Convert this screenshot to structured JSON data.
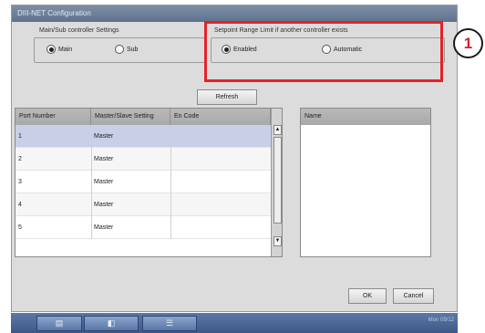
{
  "window": {
    "title": "DIII-NET Configuration"
  },
  "main_sub": {
    "label": "Main/Sub controller Settings",
    "options": [
      "Main",
      "Sub"
    ],
    "selected": "Main"
  },
  "setpoint": {
    "label": "Setpoint Range Limit if another controller exists",
    "options": [
      "Enabled",
      "Automatic"
    ],
    "selected": "Enabled"
  },
  "refresh_label": "Refresh",
  "ports_table": {
    "headers": [
      "Port Number",
      "Master/Slave Setting",
      "En Code"
    ],
    "rows": [
      {
        "port": "1",
        "setting": "Master",
        "code": ""
      },
      {
        "port": "2",
        "setting": "Master",
        "code": ""
      },
      {
        "port": "3",
        "setting": "Master",
        "code": ""
      },
      {
        "port": "4",
        "setting": "Master",
        "code": ""
      },
      {
        "port": "5",
        "setting": "Master",
        "code": ""
      }
    ],
    "selected_row": 0
  },
  "name_table": {
    "header": "Name"
  },
  "buttons": {
    "ok": "OK",
    "cancel": "Cancel"
  },
  "callout": {
    "number": "1",
    "color": "#e2232a"
  },
  "taskbar": {
    "status": "Mon 09/12"
  },
  "icons": [
    "menu-icon",
    "monitor-icon",
    "list-icon",
    "scroll-up-icon",
    "scroll-down-icon"
  ]
}
